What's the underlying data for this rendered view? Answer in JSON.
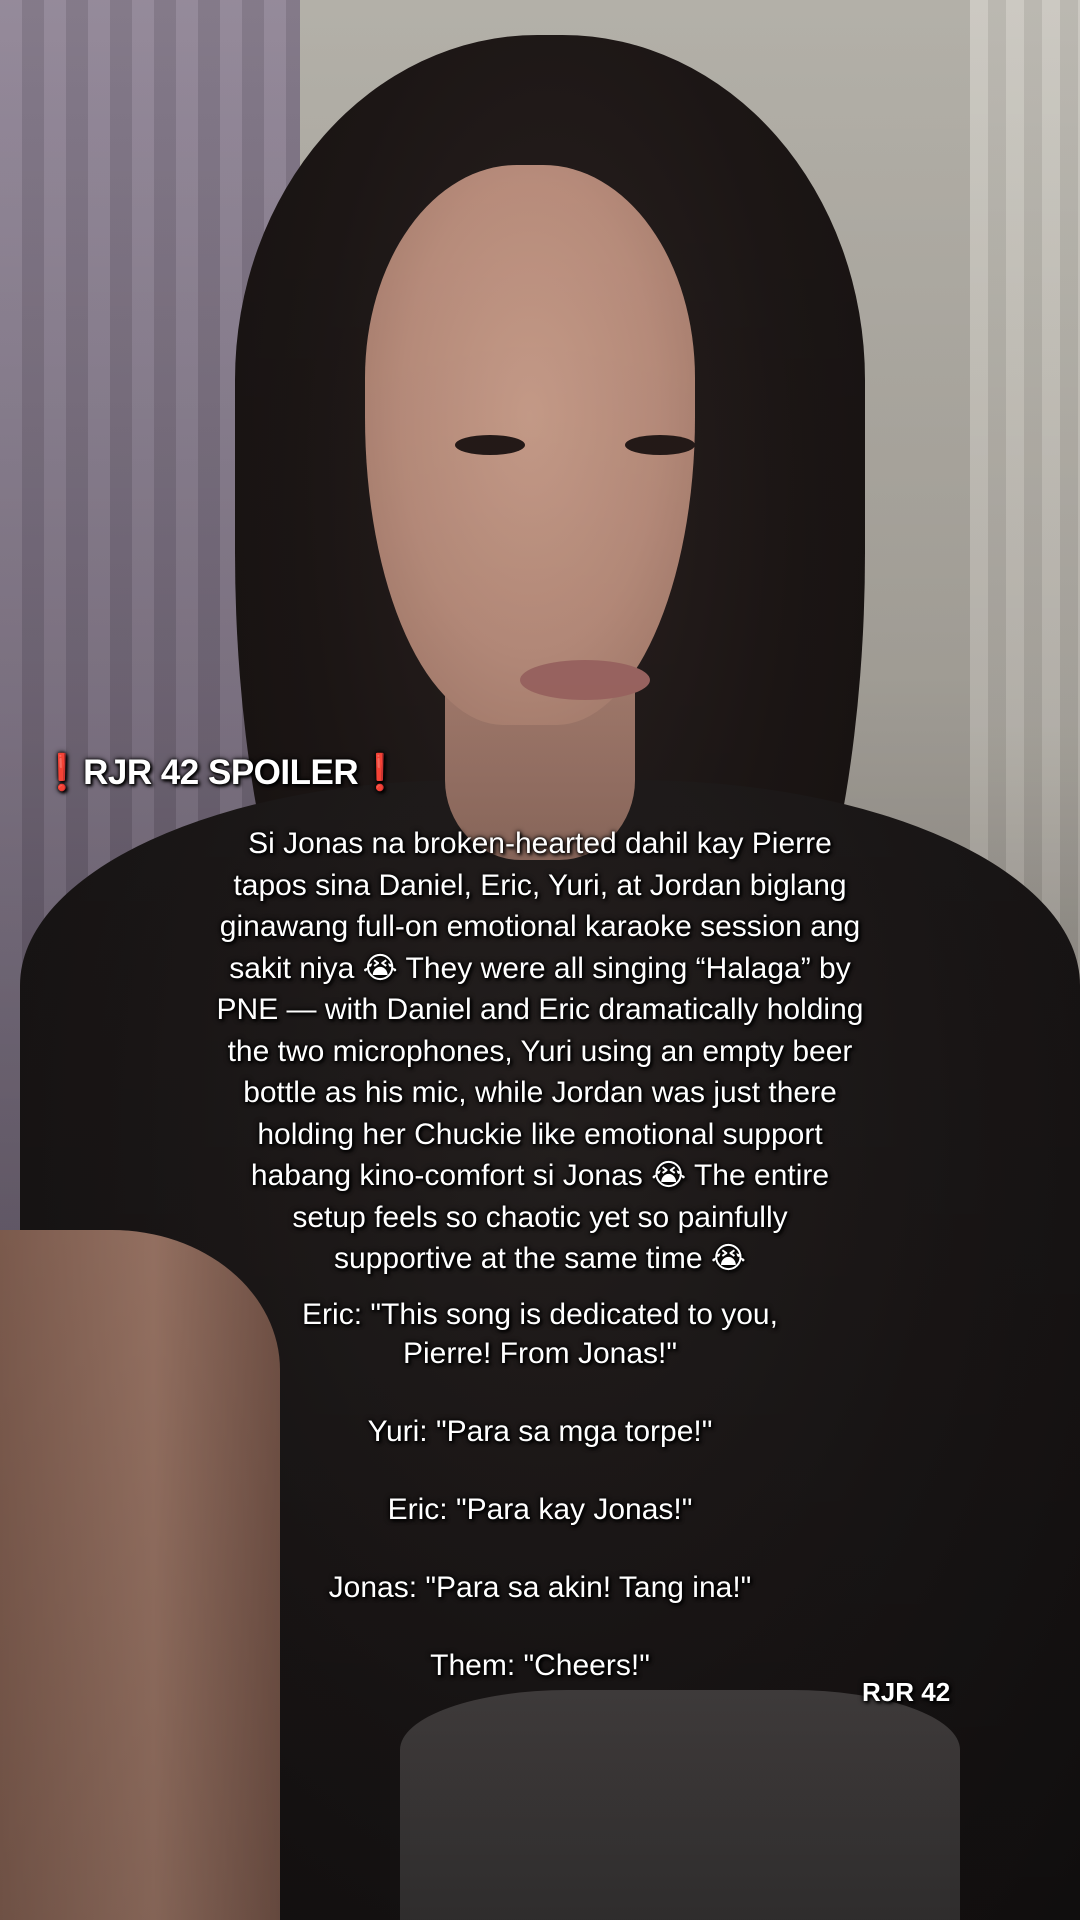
{
  "overlay": {
    "title": "RJR 42 SPOILER",
    "title_mark": "❗",
    "story_lines": [
      "Si Jonas na broken-hearted dahil kay Pierre",
      "tapos sina Daniel, Eric, Yuri, at Jordan biglang",
      "ginawang full-on emotional karaoke session ang",
      "sakit niya 😭 They were all singing “Halaga” by",
      "PNE — with Daniel and Eric dramatically holding",
      "the two microphones, Yuri using an empty beer",
      "bottle as his mic, while Jordan was just there",
      "holding her Chuckie like emotional support",
      "habang kino-comfort si Jonas 😭 The entire",
      "setup feels so chaotic yet so painfully",
      "supportive at the same time 😭"
    ],
    "dialogue_lines": [
      "Eric: \"This song is dedicated to you,",
      "Pierre! From Jonas!\"",
      "",
      "Yuri: \"Para sa mga torpe!\"",
      "",
      "Eric: \"Para kay Jonas!\"",
      "",
      "Jonas: \"Para sa akin! Tang ina!\"",
      "",
      "Them: \"Cheers!\""
    ],
    "watermark": "RJR 42"
  },
  "colors": {
    "text": "#ffffff",
    "alert_mark": "#ff1f1f"
  }
}
